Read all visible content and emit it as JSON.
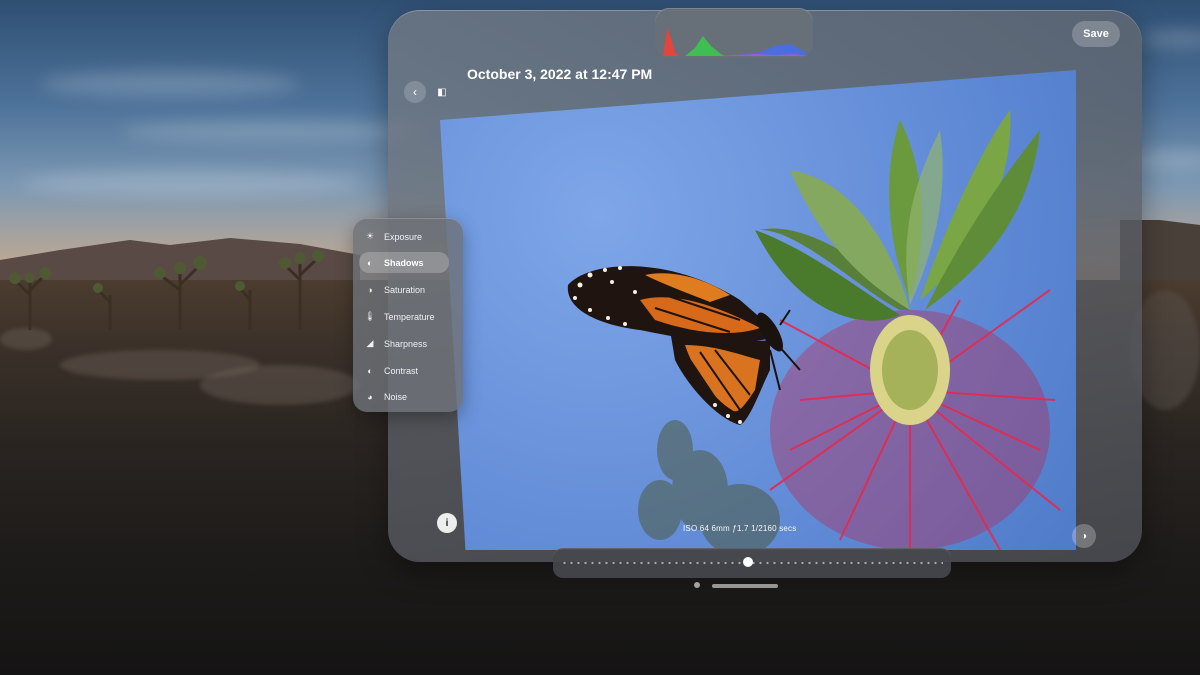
{
  "header": {
    "title": "October 3, 2022 at 12:47 PM",
    "save_label": "Save"
  },
  "icons": {
    "back": "chevron-left-icon",
    "compare": "compare-icon",
    "info": "info-icon",
    "toggle": "before-after-toggle-icon"
  },
  "adjustments": {
    "selected": "Shadows",
    "items": [
      {
        "label": "Exposure",
        "icon": "☀"
      },
      {
        "label": "Shadows",
        "icon": "◐"
      },
      {
        "label": "Saturation",
        "icon": "◑"
      },
      {
        "label": "Temperature",
        "icon": "🌡"
      },
      {
        "label": "Sharpness",
        "icon": "◢"
      },
      {
        "label": "Contrast",
        "icon": "◐"
      },
      {
        "label": "Noise",
        "icon": "◕"
      }
    ]
  },
  "photo": {
    "metadata": "ISO 64  6mm  ƒ1.7  1/2160 secs"
  },
  "slider": {
    "value_fraction": 0.49
  }
}
